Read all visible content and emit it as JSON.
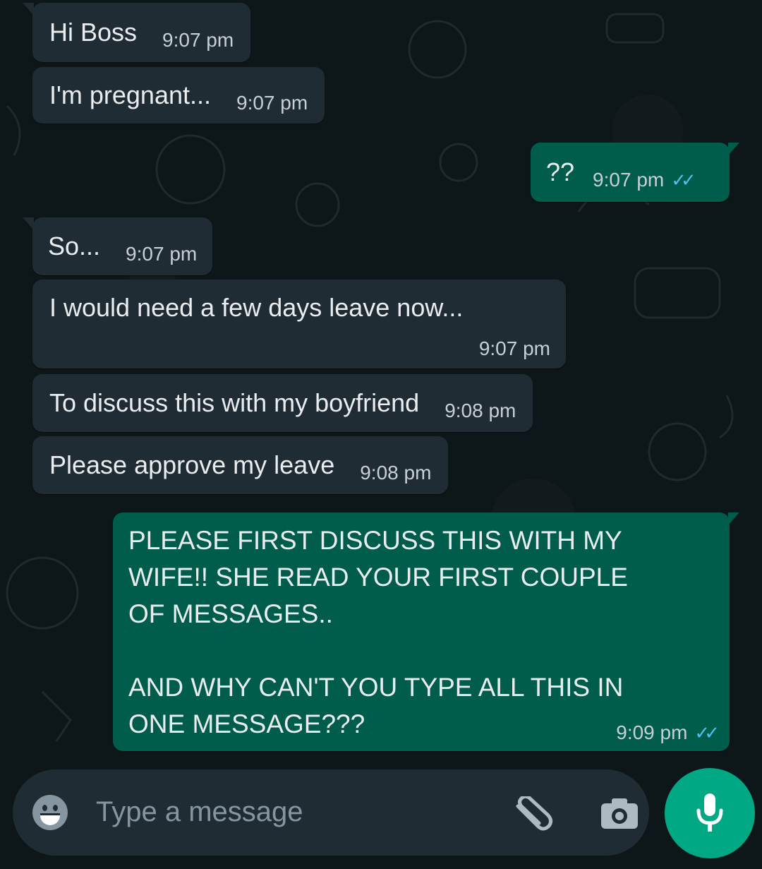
{
  "messages": [
    {
      "dir": "in",
      "text": "Hi Boss",
      "time": "9:07 pm"
    },
    {
      "dir": "in",
      "text": "I'm pregnant...",
      "time": "9:07 pm"
    },
    {
      "dir": "out",
      "text": "??",
      "time": "9:07 pm"
    },
    {
      "dir": "in",
      "text": "So...",
      "time": "9:07 pm"
    },
    {
      "dir": "in",
      "text": "I would need a few days leave now...",
      "time": "9:07 pm"
    },
    {
      "dir": "in",
      "text": "To discuss this with my boyfriend",
      "time": "9:08 pm"
    },
    {
      "dir": "in",
      "text": "Please approve my leave",
      "time": "9:08 pm"
    },
    {
      "dir": "out",
      "text": "PLEASE FIRST DISCUSS THIS WITH MY\nWIFE!! SHE READ YOUR FIRST COUPLE\nOF MESSAGES..\n\nAND WHY CAN'T YOU TYPE ALL THIS IN\nONE MESSAGE???",
      "time": "9:09 pm"
    }
  ],
  "composer": {
    "placeholder": "Type a message"
  },
  "icons": {
    "emoji": "emoji-icon",
    "attach": "paperclip-icon",
    "camera": "camera-icon",
    "mic": "microphone-icon",
    "read_receipt": "double-check-icon"
  },
  "colors": {
    "background": "#0d1619",
    "incoming_bubble": "#202c33",
    "outgoing_bubble": "#005c4b",
    "read_ticks": "#53bdeb",
    "mic_button": "#00a884"
  }
}
